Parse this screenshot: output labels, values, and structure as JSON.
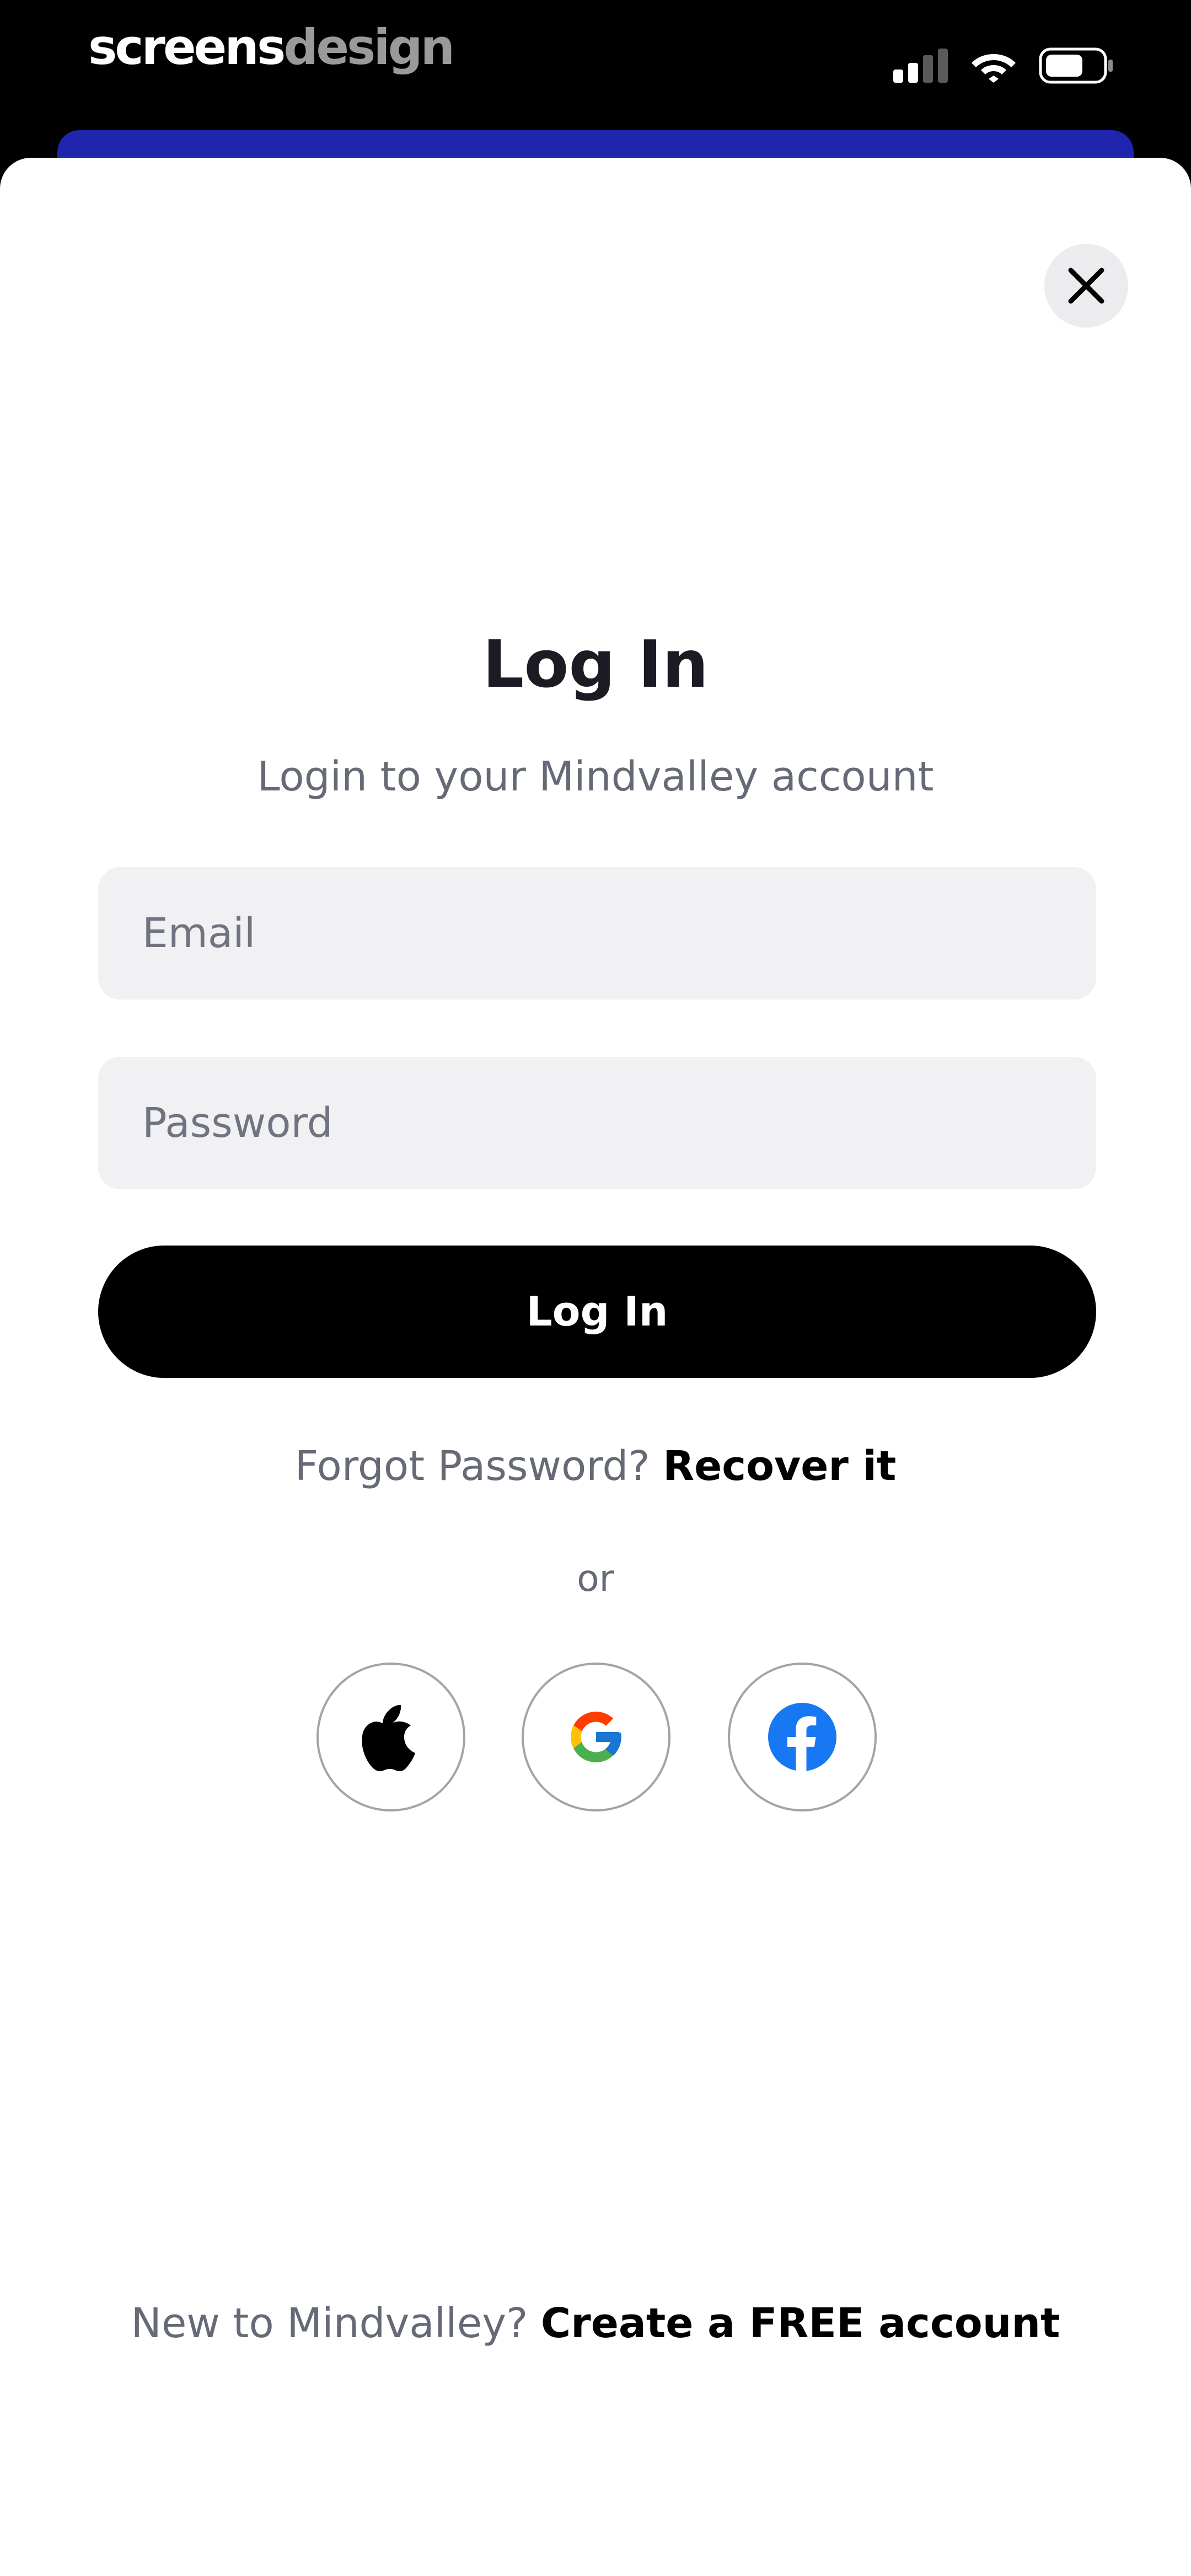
{
  "status_bar": {
    "brand_part1": "screens",
    "brand_part2": "design",
    "signal_icon": "cellular-signal-icon",
    "wifi_icon": "wifi-icon",
    "battery_icon": "battery-icon"
  },
  "sheet": {
    "close_icon": "close-icon",
    "title": "Log In",
    "subtitle": "Login to your Mindvalley account",
    "email_placeholder": "Email",
    "password_placeholder": "Password",
    "login_button_label": "Log In",
    "forgot_text": "Forgot Password?",
    "forgot_link": "Recover it",
    "or_text": "or",
    "social_buttons": [
      {
        "name": "apple",
        "icon": "apple-icon"
      },
      {
        "name": "google",
        "icon": "google-icon"
      },
      {
        "name": "facebook",
        "icon": "facebook-icon"
      }
    ],
    "signup_text": "New to Mindvalley?",
    "signup_link": "Create a FREE account"
  },
  "colors": {
    "background_card": "#1f26ad",
    "primary_button": "#000000",
    "field_background": "#f1f1f3",
    "muted_text": "#666a76",
    "facebook_blue": "#1877f2"
  }
}
